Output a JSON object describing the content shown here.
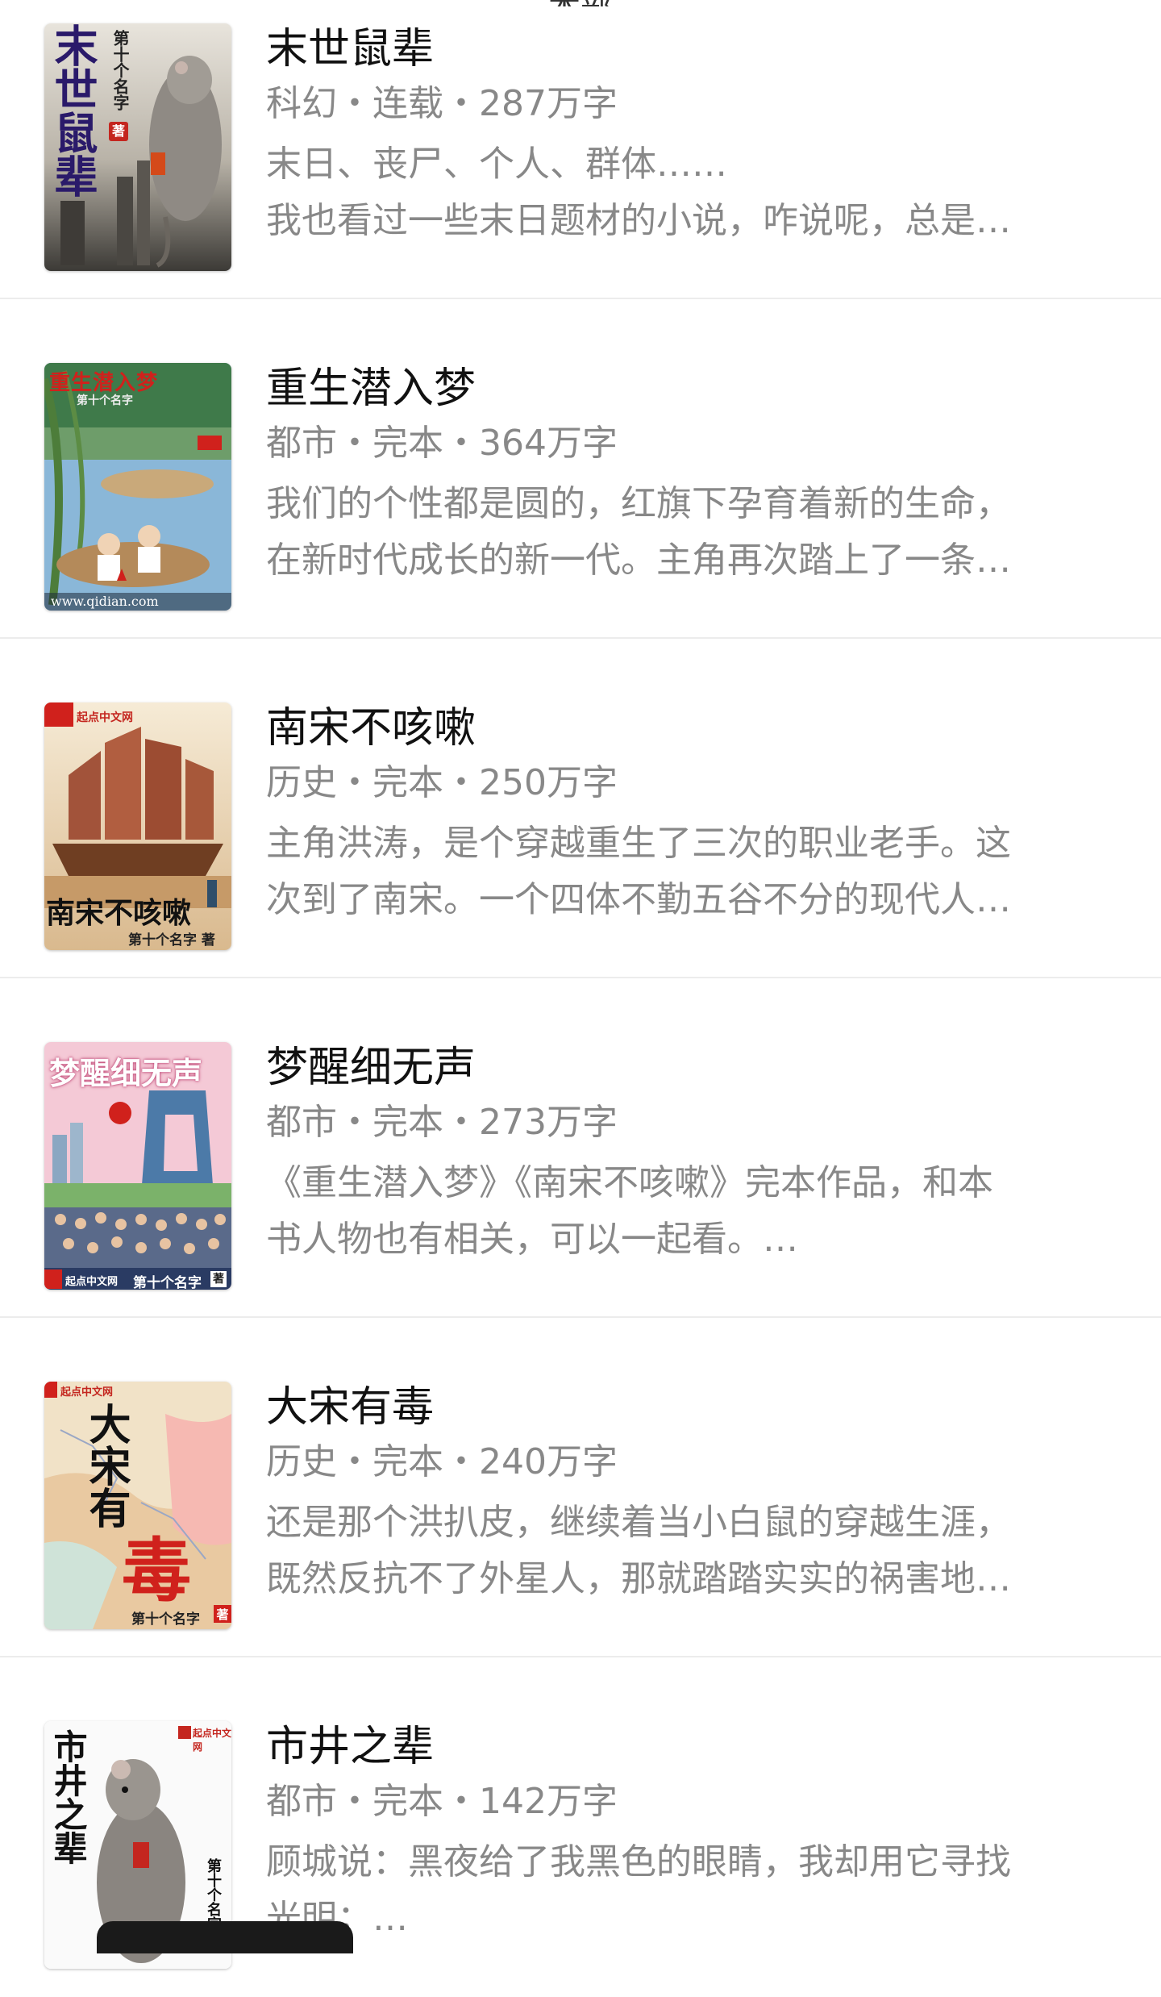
{
  "header": {
    "fragment": "本部"
  },
  "books": [
    {
      "title": "末世鼠辈",
      "meta": "科幻・连载・287万字",
      "desc_line1": "末日、丧尸、个人、群体……",
      "desc_line2": "我也看过一些末日题材的小说，咋说呢，总是…",
      "cover_title": "末世鼠辈",
      "cover_author": "第十个名字",
      "cover_author_badge": "著"
    },
    {
      "title": "重生潜入梦",
      "meta": "都市・完本・364万字",
      "desc_line1": "我们的个性都是圆的，红旗下孕育着新的生命，",
      "desc_line2": "在新时代成长的新一代。主角再次踏上了一条…",
      "cover_title": "重生潜入梦",
      "cover_author": "第十个名字",
      "cover_url": "www.qidian.com"
    },
    {
      "title": "南宋不咳嗽",
      "meta": "历史・完本・250万字",
      "desc_line1": "主角洪涛，是个穿越重生了三次的职业老手。这",
      "desc_line2": "次到了南宋。一个四体不勤五谷不分的现代人…",
      "cover_title": "南宋不咳嗽",
      "cover_author": "第十个名字 著",
      "cover_brand": "起点中文网"
    },
    {
      "title": "梦醒细无声",
      "meta": "都市・完本・273万字",
      "desc_line1": "《重生潜入梦》《南宋不咳嗽》完本作品，和本",
      "desc_line2": "书人物也有相关，可以一起看。…",
      "cover_title": "梦醒细无声",
      "cover_author": "第十个名字",
      "cover_author_badge": "著",
      "cover_brand": "起点中文网"
    },
    {
      "title": "大宋有毒",
      "meta": "历史・完本・240万字",
      "desc_line1": "还是那个洪扒皮，继续着当小白鼠的穿越生涯，",
      "desc_line2": "既然反抗不了外星人，那就踏踏实实的祸害地…",
      "cover_title_a": "大宋有",
      "cover_title_b": "毒",
      "cover_author": "第十个名字",
      "cover_author_badge": "著",
      "cover_brand": "起点中文网"
    },
    {
      "title": "市井之辈",
      "meta": "都市・完本・142万字",
      "desc_line1": "顾城说：黑夜给了我黑色的眼睛，我却用它寻找",
      "desc_line2": "光明；…",
      "cover_title": "市井之辈",
      "cover_author": "第十个名字",
      "cover_brand": "起点中文网"
    }
  ],
  "colors": {
    "title": "#111111",
    "secondary": "#888888",
    "divider": "#ececec",
    "brand_red": "#d0211c"
  }
}
